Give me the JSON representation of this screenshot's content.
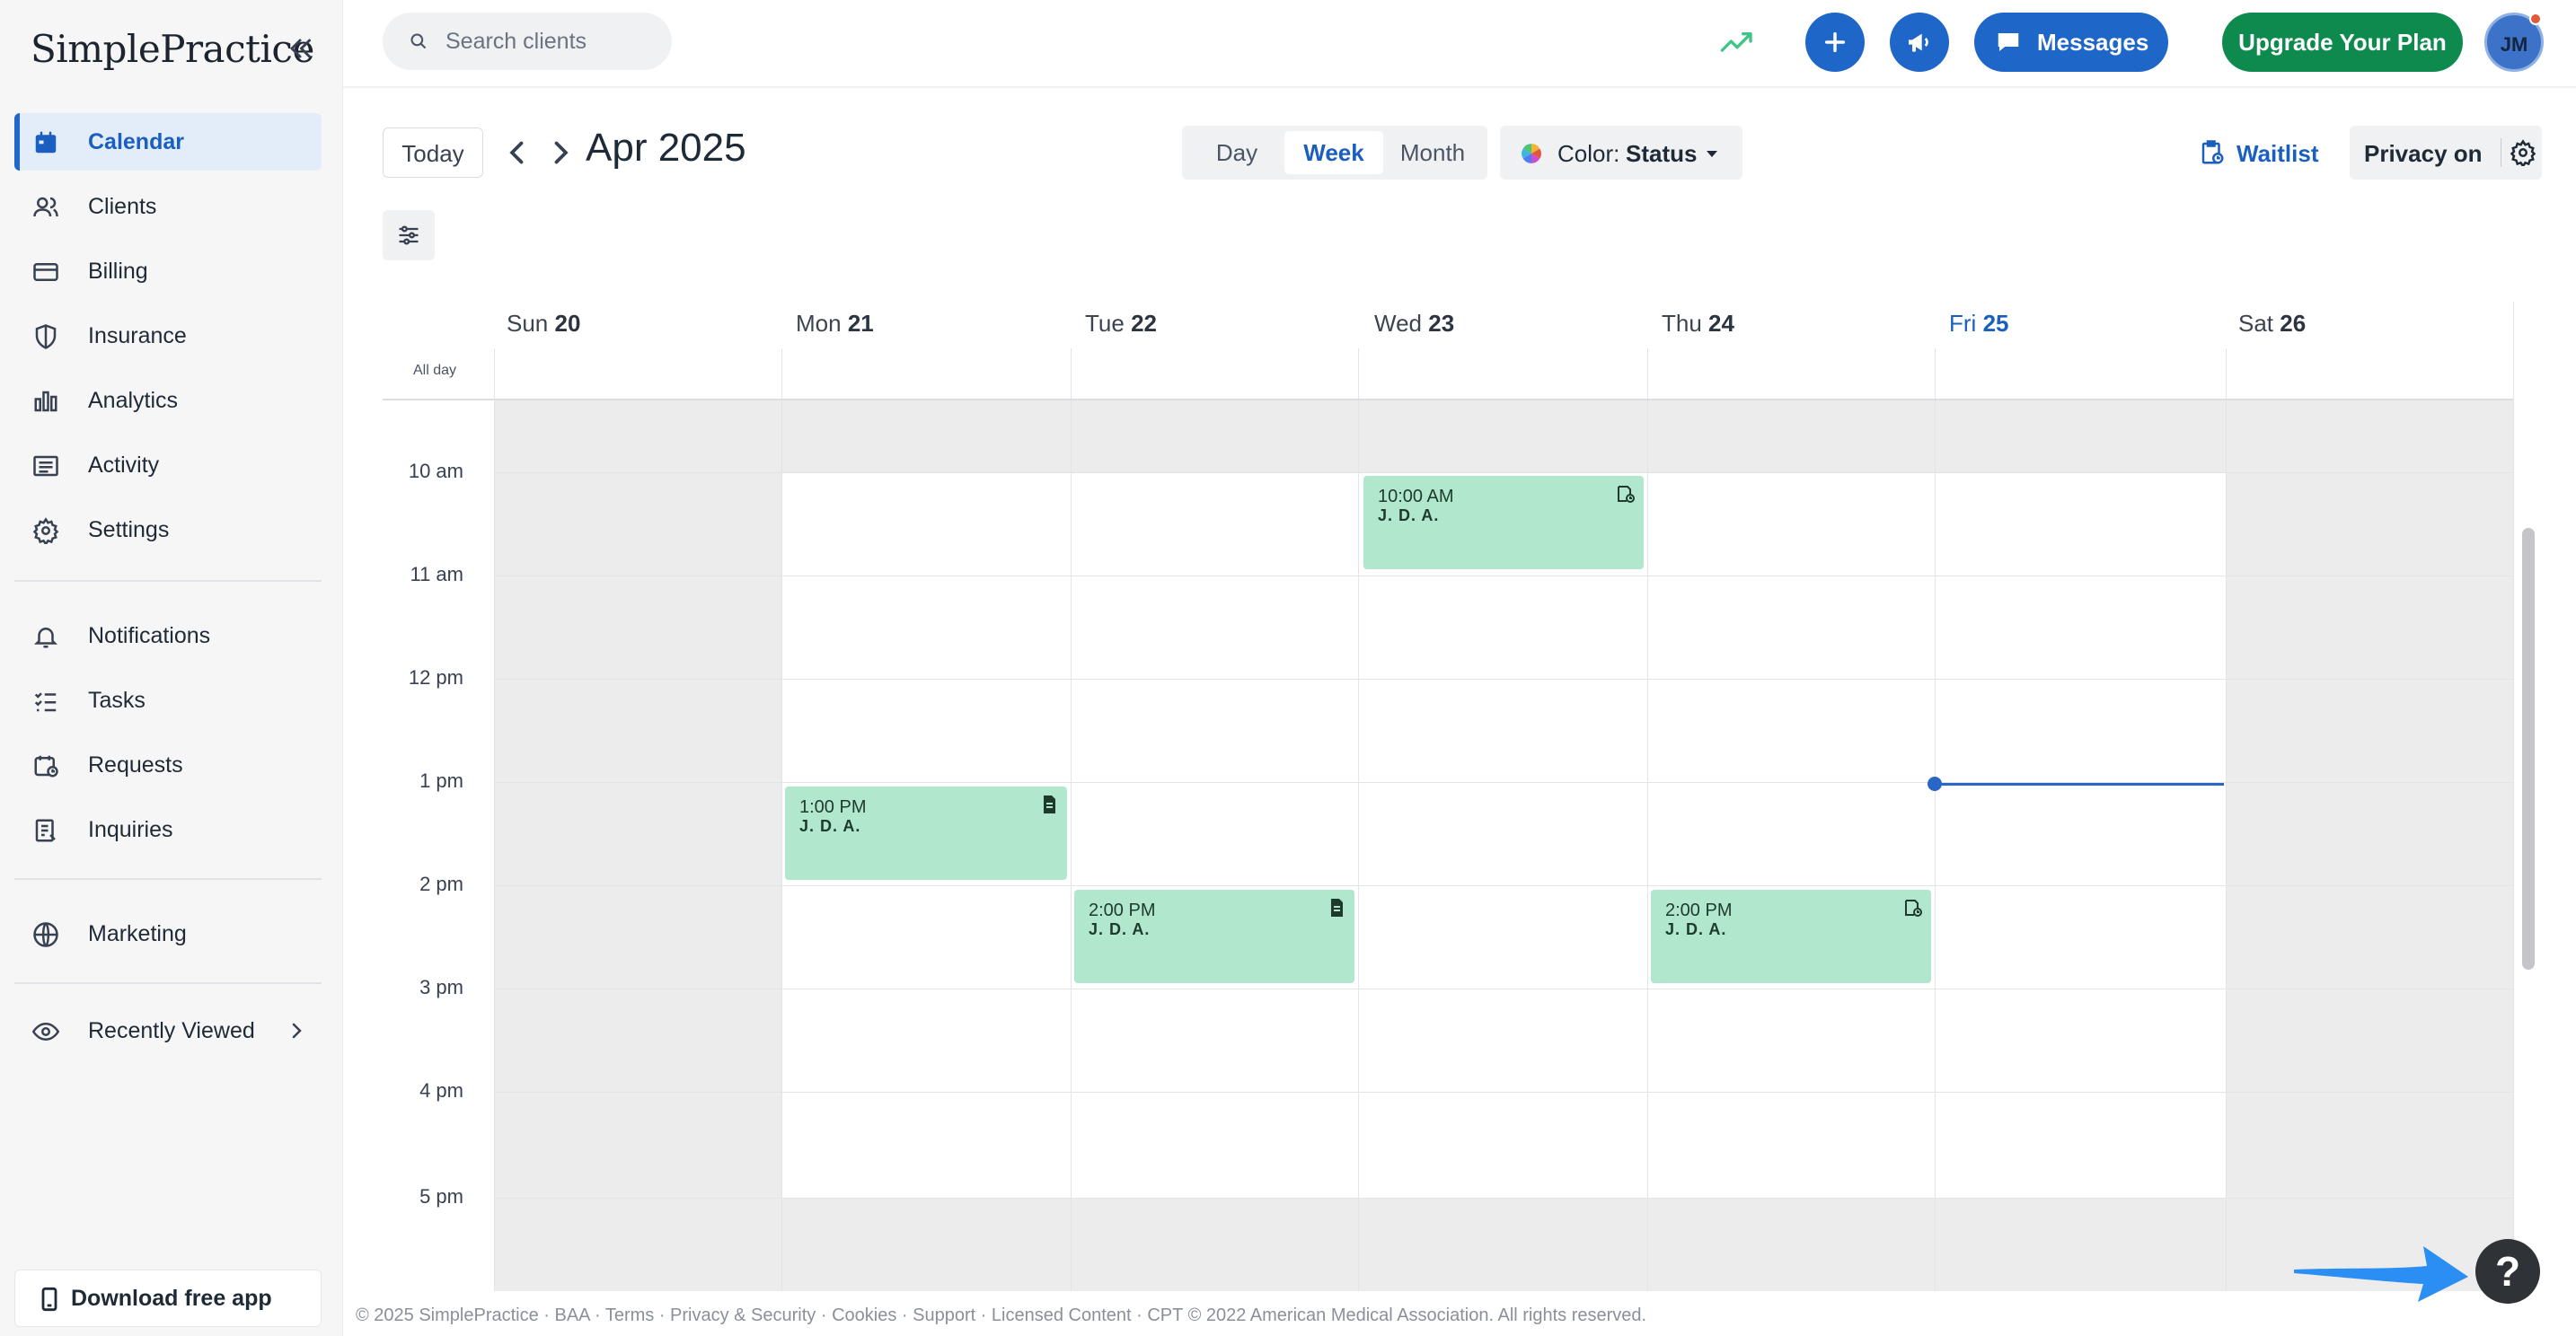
{
  "app": {
    "logo": "SimplePractice"
  },
  "sidebar": {
    "items": [
      {
        "id": "calendar",
        "label": "Calendar",
        "icon": "calendar-icon",
        "active": true
      },
      {
        "id": "clients",
        "label": "Clients",
        "icon": "clients-icon"
      },
      {
        "id": "billing",
        "label": "Billing",
        "icon": "credit-card-icon"
      },
      {
        "id": "insurance",
        "label": "Insurance",
        "icon": "shield-icon"
      },
      {
        "id": "analytics",
        "label": "Analytics",
        "icon": "bar-chart-icon"
      },
      {
        "id": "activity",
        "label": "Activity",
        "icon": "list-icon"
      },
      {
        "id": "settings",
        "label": "Settings",
        "icon": "gear-icon"
      },
      {
        "id": "notifications",
        "label": "Notifications",
        "icon": "bell-icon"
      },
      {
        "id": "tasks",
        "label": "Tasks",
        "icon": "checklist-icon"
      },
      {
        "id": "requests",
        "label": "Requests",
        "icon": "calendar-clock-icon"
      },
      {
        "id": "inquiries",
        "label": "Inquiries",
        "icon": "document-list-icon"
      },
      {
        "id": "marketing",
        "label": "Marketing",
        "icon": "globe-icon"
      },
      {
        "id": "recently-viewed",
        "label": "Recently Viewed",
        "icon": "eye-icon"
      }
    ],
    "download_app": "Download free app"
  },
  "topbar": {
    "search_placeholder": "Search clients",
    "messages_label": "Messages",
    "upgrade_label": "Upgrade Your Plan",
    "avatar_initials": "JM"
  },
  "toolbar": {
    "today_label": "Today",
    "month_label": "Apr 2025",
    "views": [
      "Day",
      "Week",
      "Month"
    ],
    "active_view": "Week",
    "color_prefix": "Color:",
    "color_value": "Status",
    "waitlist_label": "Waitlist",
    "privacy_label": "Privacy on"
  },
  "calendar": {
    "days": [
      {
        "name": "Sun",
        "date": "20"
      },
      {
        "name": "Mon",
        "date": "21"
      },
      {
        "name": "Tue",
        "date": "22"
      },
      {
        "name": "Wed",
        "date": "23"
      },
      {
        "name": "Thu",
        "date": "24"
      },
      {
        "name": "Fri",
        "date": "25",
        "today": true
      },
      {
        "name": "Sat",
        "date": "26"
      }
    ],
    "all_day_label": "All day",
    "times": [
      "10 am",
      "11 am",
      "12 pm",
      "1 pm",
      "2 pm",
      "3 pm",
      "4 pm",
      "5 pm"
    ],
    "appointments": [
      {
        "day": "Wed",
        "time": "10:00 AM",
        "client": "J. D. A.",
        "icon": "calendar-video-icon"
      },
      {
        "day": "Mon",
        "time": "1:00 PM",
        "client": "J. D. A.",
        "icon": "note-icon"
      },
      {
        "day": "Tue",
        "time": "2:00 PM",
        "client": "J. D. A.",
        "icon": "note-icon"
      },
      {
        "day": "Thu",
        "time": "2:00 PM",
        "client": "J. D. A.",
        "icon": "calendar-video-icon"
      }
    ],
    "appointment_color": "#b1e8cd",
    "today_color": "#1a5fc0"
  },
  "footer": {
    "text": "© 2025 SimplePractice · BAA · Terms · Privacy & Security · Cookies · Support · Licensed Content · CPT © 2022 American Medical Association. All rights reserved."
  },
  "help": {
    "label": "?"
  }
}
